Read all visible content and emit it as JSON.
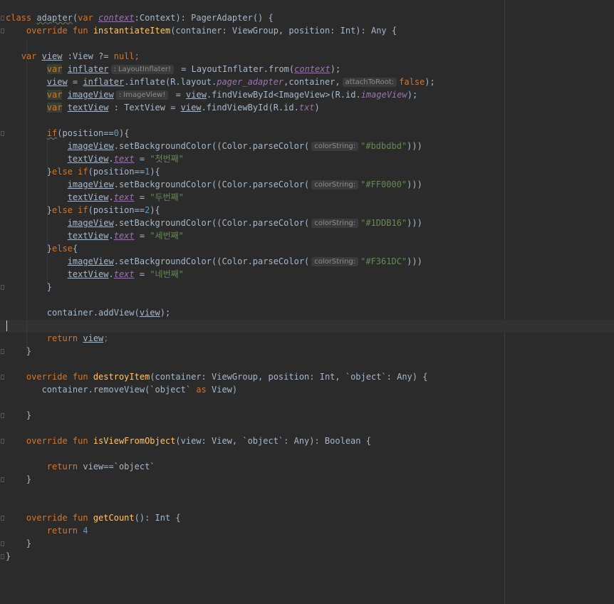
{
  "editor": {
    "language": "Kotlin",
    "theme": "Darcula",
    "colors": {
      "background": "#2b2b2b",
      "keyword": "#cc7832",
      "function": "#ffc66d",
      "string": "#6a8759",
      "number": "#6897bb",
      "property": "#9876aa",
      "plain": "#a9b7c6",
      "hint": "#8c8c8c"
    },
    "code": {
      "l1": {
        "a": "class ",
        "b": "adapter",
        "c": "(",
        "d": "var ",
        "e": "context",
        "f": ":Context): PagerAdapter() {"
      },
      "l2": {
        "a": "override fun ",
        "b": "instantiateItem",
        "c": "(container: ViewGroup, position: Int): Any {"
      },
      "l4": {
        "a": "var ",
        "b": "view",
        "c": " :View ?= ",
        "d": "null",
        "e": ";"
      },
      "l5": {
        "a": "var",
        "b": " ",
        "c": "inflater",
        "hint": ": LayoutInflater!",
        "d": " = LayoutInflater.from(",
        "e": "context",
        "f": ");"
      },
      "l6": {
        "a": "view",
        "b": " = ",
        "c": "inflater",
        "d": ".inflate(R.layout.",
        "e": "pager_adapter",
        "f": ",container,",
        "hint": "attachToRoot:",
        "g": "false",
        "h": ");"
      },
      "l7": {
        "a": "var",
        "b": " ",
        "c": "imageView",
        "hint": ": ImageView!",
        "d": " = ",
        "e": "view",
        "f": ".findViewById<ImageView>(R.id.",
        "g": "imageView",
        "h": ");"
      },
      "l8": {
        "a": "var",
        "b": " ",
        "c": "textView",
        "d": " : TextView = ",
        "e": "view",
        "f": ".findViewById(R.id.",
        "g": "txt",
        "h": ")"
      },
      "l10": {
        "a": "if",
        "b": "(position==",
        "c": "0",
        "d": "){"
      },
      "l11": {
        "a": "imageView",
        "b": ".setBackgroundColor((Color.parseColor(",
        "hint": "colorString:",
        "c": "\"#bdbdbd\"",
        "d": ")))"
      },
      "l12": {
        "a": "textView",
        "b": ".",
        "c": "text",
        "d": " = ",
        "e": "\"첫번째\""
      },
      "l13": {
        "a": "}",
        "b": "else if",
        "c": "(position==",
        "d": "1",
        "e": "){"
      },
      "l14": {
        "a": "imageView",
        "b": ".setBackgroundColor((Color.parseColor(",
        "hint": "colorString:",
        "c": "\"#FF0000\"",
        "d": ")))"
      },
      "l15": {
        "a": "textView",
        "b": ".",
        "c": "text",
        "d": " = ",
        "e": "\"두번째\""
      },
      "l16": {
        "a": "}",
        "b": "else if",
        "c": "(position==",
        "d": "2",
        "e": "){"
      },
      "l17": {
        "a": "imageView",
        "b": ".setBackgroundColor((Color.parseColor(",
        "hint": "colorString:",
        "c": "\"#1DDB16\"",
        "d": ")))"
      },
      "l18": {
        "a": "textView",
        "b": ".",
        "c": "text",
        "d": " = ",
        "e": "\"세번째\""
      },
      "l19": {
        "a": "}",
        "b": "else",
        "c": "{"
      },
      "l20": {
        "a": "imageView",
        "b": ".setBackgroundColor((Color.parseColor(",
        "hint": "colorString:",
        "c": "\"#F361DC\"",
        "d": ")))"
      },
      "l21": {
        "a": "textView",
        "b": ".",
        "c": "text",
        "d": " = ",
        "e": "\"네번째\""
      },
      "l22": {
        "a": "}"
      },
      "l24": {
        "a": "container.addView(",
        "b": "view",
        "c": ");"
      },
      "l26": {
        "a": "return ",
        "b": "view",
        "c": ";"
      },
      "l27": {
        "a": "}"
      },
      "l29": {
        "a": "override fun ",
        "b": "destroyItem",
        "c": "(container: ViewGroup, position: Int, `object`: Any) {"
      },
      "l30": {
        "a": "container.removeView(`object` ",
        "b": "as",
        "c": " View)"
      },
      "l32": {
        "a": "}"
      },
      "l34": {
        "a": "override fun ",
        "b": "isViewFromObject",
        "c": "(view: View, `object`: Any): Boolean {"
      },
      "l36": {
        "a": "return ",
        "b": "view==`object`"
      },
      "l37": {
        "a": "}"
      },
      "l40": {
        "a": "override fun ",
        "b": "getCount",
        "c": "(): Int {"
      },
      "l41": {
        "a": "return ",
        "b": "4"
      },
      "l42": {
        "a": "}"
      },
      "l43": {
        "a": "}"
      }
    }
  }
}
